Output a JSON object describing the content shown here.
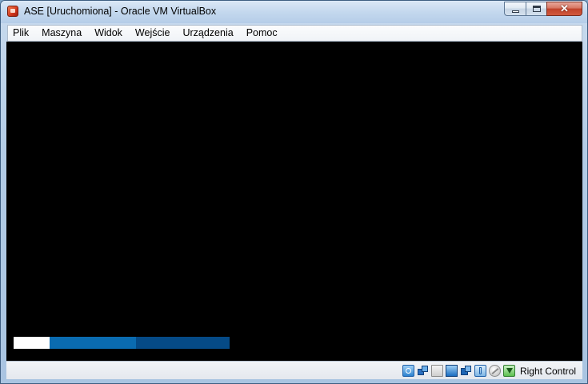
{
  "window": {
    "title": "ASE [Uruchomiona] - Oracle VM VirtualBox"
  },
  "menu": {
    "items": [
      {
        "label": "Plik"
      },
      {
        "label": "Maszyna"
      },
      {
        "label": "Widok"
      },
      {
        "label": "Wejście"
      },
      {
        "label": "Urządzenia"
      },
      {
        "label": "Pomoc"
      }
    ]
  },
  "vm_screen": {
    "background": "#000000",
    "boot_progress": {
      "segments": [
        {
          "color": "#ffffff"
        },
        {
          "color": "#0a6bb0"
        },
        {
          "color": "#054a86"
        }
      ]
    }
  },
  "statusbar": {
    "icons": [
      "hard-disk-icon",
      "network-icon",
      "shared-folder-icon",
      "display-icon",
      "video-capture-icon",
      "usb-icon",
      "mouse-integration-icon",
      "host-key-arrow-icon"
    ],
    "host_key_label": "Right Control"
  }
}
